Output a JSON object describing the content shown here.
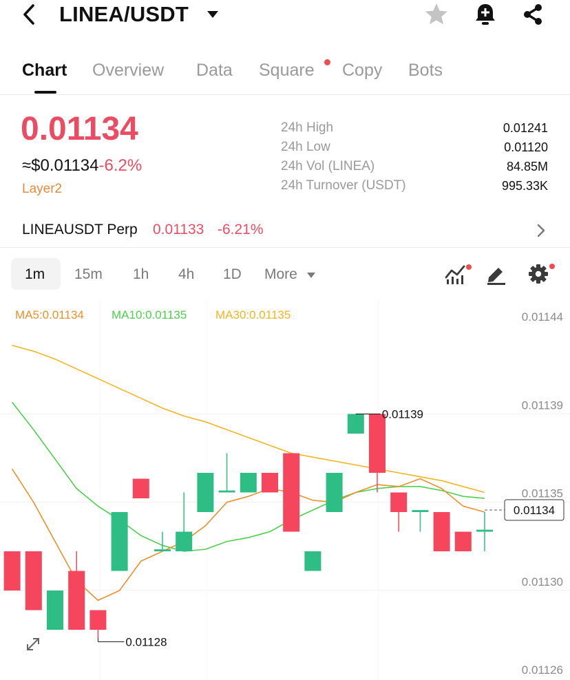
{
  "header": {
    "pair": "LINEA/USDT",
    "icons": [
      "back-icon",
      "caret-down-icon",
      "star-icon",
      "bell-alert-icon",
      "share-icon"
    ]
  },
  "tabs": [
    {
      "label": "Chart",
      "active": true
    },
    {
      "label": "Overview"
    },
    {
      "label": "Data"
    },
    {
      "label": "Square",
      "badge": true
    },
    {
      "label": "Copy"
    },
    {
      "label": "Bots"
    }
  ],
  "price": {
    "last": "0.01134",
    "usd": "≈$0.01134",
    "change": "-6.2%",
    "tag": "Layer2"
  },
  "stats": [
    {
      "label": "24h High",
      "value": "0.01241"
    },
    {
      "label": "24h Low",
      "value": "0.01120"
    },
    {
      "label": "24h Vol (LINEA)",
      "value": "84.85M"
    },
    {
      "label": "24h Turnover (USDT)",
      "value": "995.33K"
    }
  ],
  "perp": {
    "name": "LINEAUSDT Perp",
    "price": "0.01133",
    "change": "-6.21%"
  },
  "toolbar": {
    "timeframes": [
      "1m",
      "15m",
      "1h",
      "4h",
      "1D"
    ],
    "active_timeframe": "1m",
    "more": "More",
    "icons": [
      "indicators-icon",
      "draw-icon",
      "settings-icon"
    ]
  },
  "chart_data": {
    "type": "candlestick",
    "legend": [
      {
        "label": "MA5:0.01134",
        "color": "#e8902a"
      },
      {
        "label": "MA10:0.01135",
        "color": "#4ccf4c"
      },
      {
        "label": "MA30:0.01135",
        "color": "#f2b51e"
      }
    ],
    "y_ticks": [
      "0.01144",
      "0.01139",
      "0.01135",
      "0.01130",
      "0.01126"
    ],
    "y_tick_values": [
      0.01144,
      0.011395,
      0.01135,
      0.011305,
      0.01126
    ],
    "ylim": [
      0.01126,
      0.01144
    ],
    "current_price_label": "0.01134",
    "max_label": "0.01139",
    "min_label": "0.01128",
    "candles": [
      {
        "o": 0.01132,
        "c": 0.0113,
        "h": 0.01132,
        "l": 0.0113
      },
      {
        "o": 0.01132,
        "c": 0.01129,
        "h": 0.01132,
        "l": 0.01129
      },
      {
        "o": 0.01128,
        "c": 0.0113,
        "h": 0.0113,
        "l": 0.01128
      },
      {
        "o": 0.01131,
        "c": 0.01128,
        "h": 0.01132,
        "l": 0.01128
      },
      {
        "o": 0.01129,
        "c": 0.01128,
        "h": 0.01129,
        "l": 0.011276
      },
      {
        "o": 0.01131,
        "c": 0.01134,
        "h": 0.01134,
        "l": 0.01131
      },
      {
        "o": 0.011357,
        "c": 0.011347,
        "h": 0.011357,
        "l": 0.011347
      },
      {
        "o": 0.01132,
        "c": 0.011321,
        "h": 0.01133,
        "l": 0.01132
      },
      {
        "o": 0.01132,
        "c": 0.01133,
        "h": 0.01135,
        "l": 0.01132
      },
      {
        "o": 0.01134,
        "c": 0.01136,
        "h": 0.01136,
        "l": 0.01134
      },
      {
        "o": 0.01135,
        "c": 0.011351,
        "h": 0.01137,
        "l": 0.01135
      },
      {
        "o": 0.01135,
        "c": 0.01136,
        "h": 0.01136,
        "l": 0.01135
      },
      {
        "o": 0.01136,
        "c": 0.01135,
        "h": 0.01136,
        "l": 0.01135
      },
      {
        "o": 0.01137,
        "c": 0.01133,
        "h": 0.01137,
        "l": 0.01133
      },
      {
        "o": 0.01131,
        "c": 0.01132,
        "h": 0.01132,
        "l": 0.01131
      },
      {
        "o": 0.01134,
        "c": 0.01136,
        "h": 0.01136,
        "l": 0.01134
      },
      {
        "o": 0.01138,
        "c": 0.01139,
        "h": 0.01139,
        "l": 0.01138
      },
      {
        "o": 0.01139,
        "c": 0.01136,
        "h": 0.01139,
        "l": 0.01135
      },
      {
        "o": 0.01135,
        "c": 0.01134,
        "h": 0.01135,
        "l": 0.01133
      },
      {
        "o": 0.01134,
        "c": 0.011341,
        "h": 0.01134,
        "l": 0.01133
      },
      {
        "o": 0.01134,
        "c": 0.01132,
        "h": 0.01134,
        "l": 0.01132
      },
      {
        "o": 0.01133,
        "c": 0.01132,
        "h": 0.01133,
        "l": 0.01132
      },
      {
        "o": 0.01133,
        "c": 0.011331,
        "h": 0.01134,
        "l": 0.01132
      }
    ],
    "ma5": [
      0.011362,
      0.011345,
      0.011325,
      0.011305,
      0.011295,
      0.0113,
      0.011315,
      0.01132,
      0.011325,
      0.011333,
      0.011345,
      0.011348,
      0.011352,
      0.01135,
      0.011346,
      0.011345,
      0.01135,
      0.011354,
      0.011353,
      0.011357,
      0.011352,
      0.011343,
      0.01134
    ],
    "ma10": [
      0.011396,
      0.011382,
      0.011367,
      0.011352,
      0.011343,
      0.011336,
      0.011328,
      0.011323,
      0.01132,
      0.011321,
      0.011325,
      0.011327,
      0.01133,
      0.011336,
      0.011341,
      0.011346,
      0.01135,
      0.011352,
      0.011353,
      0.011353,
      0.011351,
      0.011348,
      0.011347
    ],
    "ma30": [
      0.011425,
      0.011422,
      0.011418,
      0.011413,
      0.011408,
      0.011403,
      0.011398,
      0.011393,
      0.011389,
      0.011386,
      0.011382,
      0.011378,
      0.011374,
      0.01137,
      0.011368,
      0.011366,
      0.011364,
      0.011362,
      0.01136,
      0.011358,
      0.011356,
      0.011353,
      0.01135
    ],
    "colors": {
      "up": "#2ebd85",
      "down": "#f6465d"
    }
  }
}
